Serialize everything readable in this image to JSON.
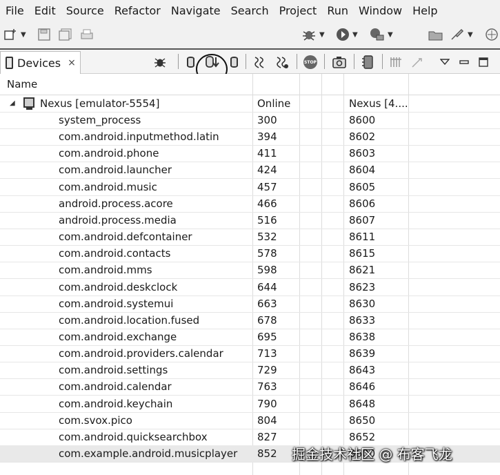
{
  "menubar": {
    "items": [
      "File",
      "Edit",
      "Source",
      "Refactor",
      "Navigate",
      "Search",
      "Project",
      "Run",
      "Window",
      "Help"
    ]
  },
  "toolbar": {
    "icons": [
      "new-wizard-icon",
      "save-icon",
      "save-all-icon",
      "print-icon",
      "debug-icon",
      "run-icon",
      "external-tools-icon",
      "open-perspective-icon",
      "launch-icon",
      "perspective-icon"
    ]
  },
  "view": {
    "tab_label": "Devices",
    "close_glyph": "⨯"
  },
  "table": {
    "column_header": "Name",
    "device": {
      "name": "Nexus [emulator-5554]",
      "status": "Online",
      "avd": "Nexus [4...."
    },
    "processes": [
      {
        "name": "system_process",
        "pid": "300",
        "port": "8600"
      },
      {
        "name": "com.android.inputmethod.latin",
        "pid": "394",
        "port": "8602"
      },
      {
        "name": "com.android.phone",
        "pid": "411",
        "port": "8603"
      },
      {
        "name": "com.android.launcher",
        "pid": "424",
        "port": "8604"
      },
      {
        "name": "com.android.music",
        "pid": "457",
        "port": "8605"
      },
      {
        "name": "android.process.acore",
        "pid": "466",
        "port": "8606"
      },
      {
        "name": "android.process.media",
        "pid": "516",
        "port": "8607"
      },
      {
        "name": "com.android.defcontainer",
        "pid": "532",
        "port": "8611"
      },
      {
        "name": "com.android.contacts",
        "pid": "578",
        "port": "8615"
      },
      {
        "name": "com.android.mms",
        "pid": "598",
        "port": "8621"
      },
      {
        "name": "com.android.deskclock",
        "pid": "644",
        "port": "8623"
      },
      {
        "name": "com.android.systemui",
        "pid": "663",
        "port": "8630"
      },
      {
        "name": "com.android.location.fused",
        "pid": "678",
        "port": "8633"
      },
      {
        "name": "com.android.exchange",
        "pid": "695",
        "port": "8638"
      },
      {
        "name": "com.android.providers.calendar",
        "pid": "713",
        "port": "8639"
      },
      {
        "name": "com.android.settings",
        "pid": "729",
        "port": "8643"
      },
      {
        "name": "com.android.calendar",
        "pid": "763",
        "port": "8646"
      },
      {
        "name": "com.android.keychain",
        "pid": "790",
        "port": "8648"
      },
      {
        "name": "com.svox.pico",
        "pid": "804",
        "port": "8650"
      },
      {
        "name": "com.android.quicksearchbox",
        "pid": "827",
        "port": "8652"
      },
      {
        "name": "com.example.android.musicplayer",
        "pid": "852",
        "port": "8600"
      }
    ]
  },
  "watermark": "掘金技术社区 @ 布客飞龙"
}
